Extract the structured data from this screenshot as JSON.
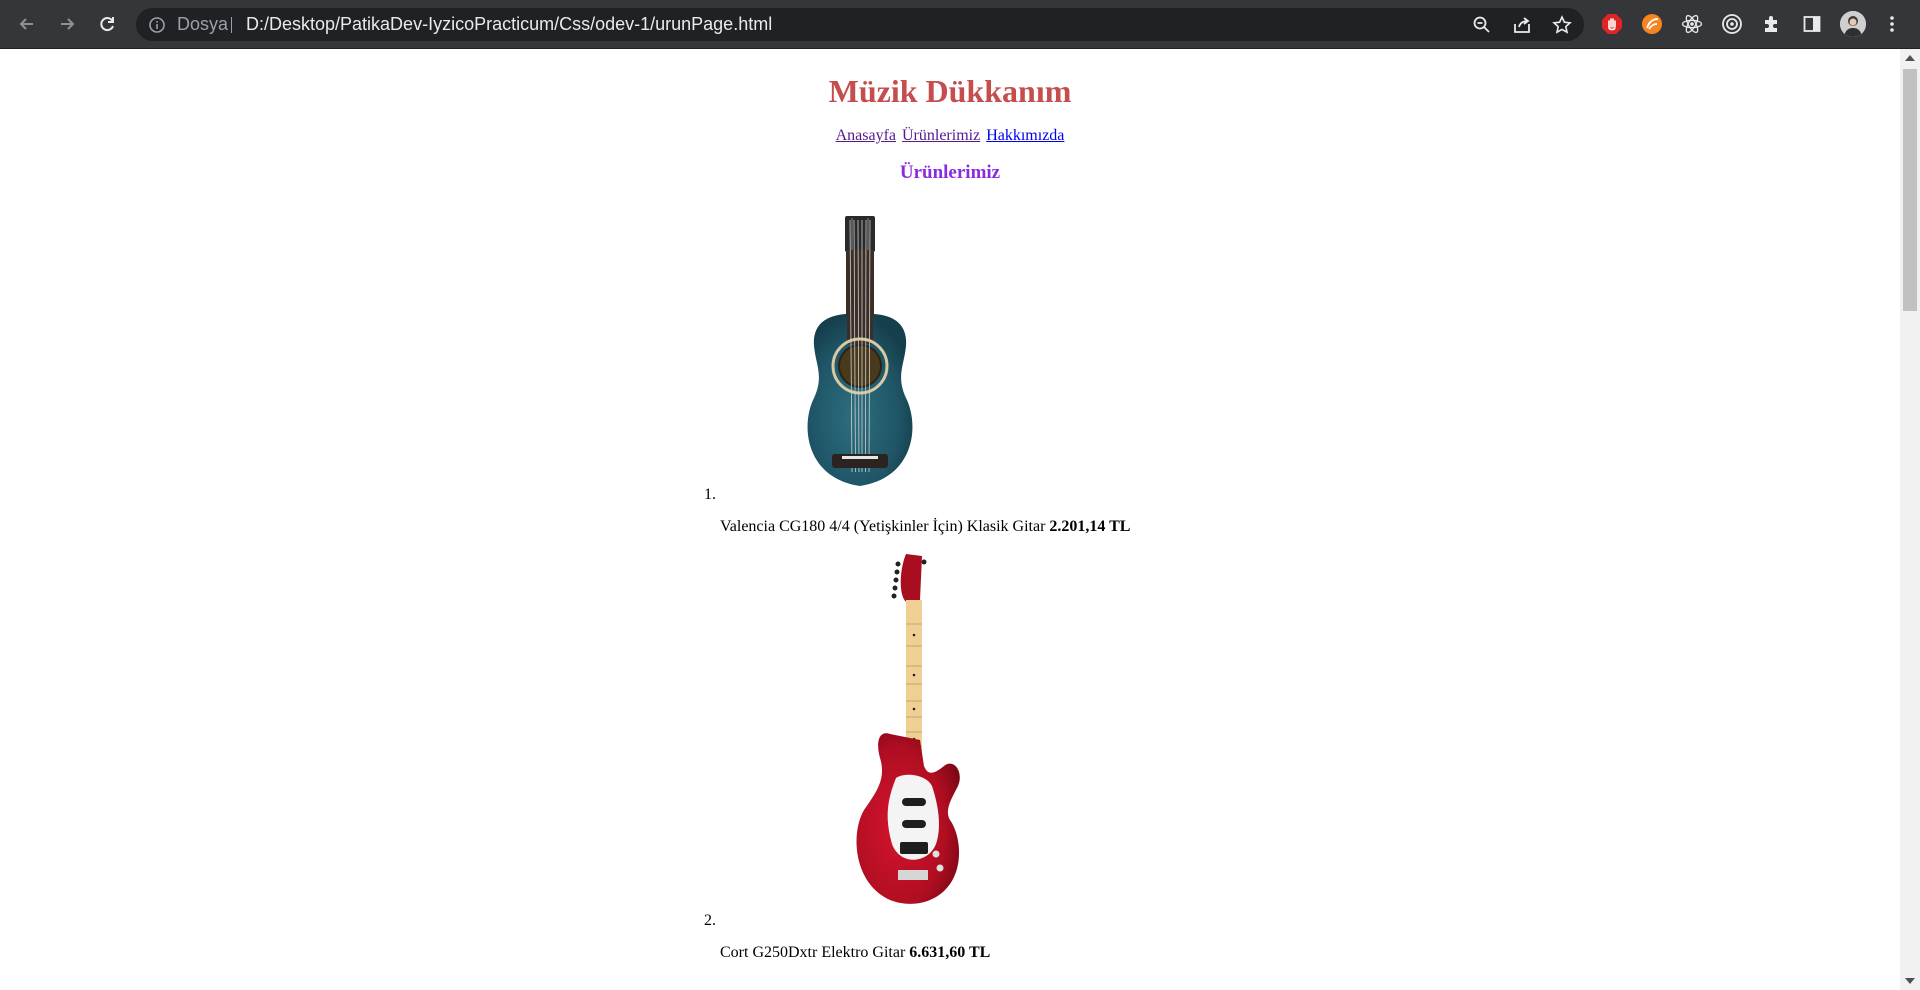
{
  "browser": {
    "site_info_label": "Dosya",
    "url": "D:/Desktop/PatikaDev-IyzicoPracticum/Css/odev-1/urunPage.html",
    "icons": [
      "back-icon",
      "forward-icon",
      "reload-icon",
      "info-icon",
      "zoom-icon",
      "share-icon",
      "star-icon",
      "extension-red-hand-icon",
      "extension-orange-icon",
      "react-devtools-icon",
      "extension-target-icon",
      "puzzle-icon",
      "side-panel-icon",
      "profile-avatar",
      "menu-icon"
    ]
  },
  "page": {
    "title": "Müzik Dükkanım",
    "nav": [
      {
        "label": "Anasayfa"
      },
      {
        "label": "Ürünlerimiz"
      },
      {
        "label": "Hakkımızda"
      }
    ],
    "section_title": "Ürünlerimiz",
    "products": [
      {
        "number": "1.",
        "name": "Valencia CG180 4/4 (Yetişkinler İçin) Klasik Gitar",
        "price": "2.201,14 TL",
        "image": "teal-classical-guitar"
      },
      {
        "number": "2.",
        "name": "Cort G250Dxtr Elektro Gitar",
        "price": "6.631,60 TL",
        "image": "red-electric-guitar"
      }
    ]
  },
  "colors": {
    "title": "#c44d4d",
    "section_title": "#8a2be2",
    "visited_link": "#551a8b",
    "link": "#0000ee",
    "chrome_bg": "#35363a"
  }
}
